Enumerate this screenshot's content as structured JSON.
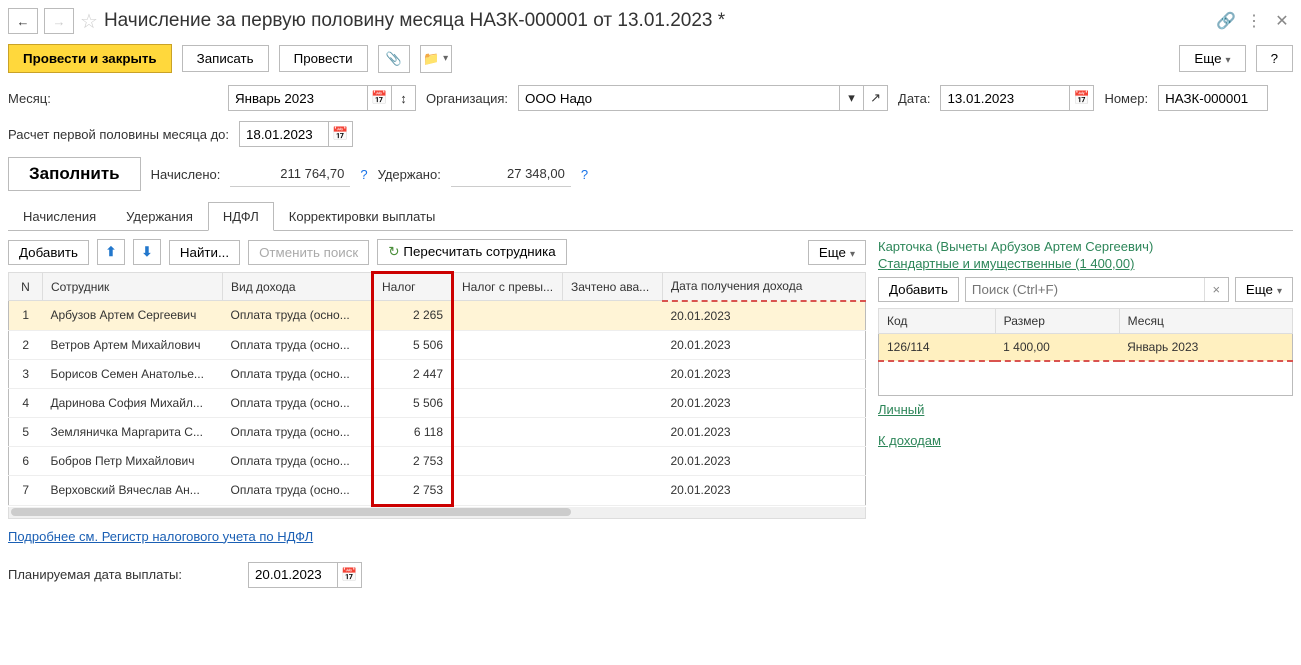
{
  "header": {
    "title": "Начисление за первую половину месяца НАЗК-000001 от 13.01.2023 *"
  },
  "toolbar": {
    "post_close": "Провести и закрыть",
    "save": "Записать",
    "post": "Провести",
    "more": "Еще"
  },
  "fields": {
    "month_label": "Месяц:",
    "month_value": "Январь 2023",
    "org_label": "Организация:",
    "org_value": "ООО Надо",
    "date_label": "Дата:",
    "date_value": "13.01.2023",
    "num_label": "Номер:",
    "num_value": "НАЗК-000001",
    "calc_until_label": "Расчет первой половины месяца до:",
    "calc_until_value": "18.01.2023",
    "fill": "Заполнить",
    "accrued_label": "Начислено:",
    "accrued_value": "211 764,70",
    "withheld_label": "Удержано:",
    "withheld_value": "27 348,00"
  },
  "tabs": {
    "t1": "Начисления",
    "t2": "Удержания",
    "t3": "НДФЛ",
    "t4": "Корректировки выплаты"
  },
  "subtb": {
    "add": "Добавить",
    "find": "Найти...",
    "cancel_find": "Отменить поиск",
    "recalc": "Пересчитать сотрудника",
    "more": "Еще"
  },
  "cols": {
    "n": "N",
    "emp": "Сотрудник",
    "inc": "Вид дохода",
    "tax": "Налог",
    "taxover": "Налог с превы...",
    "credited": "Зачтено ава...",
    "date": "Дата получения дохода"
  },
  "rows": [
    {
      "n": "1",
      "emp": "Арбузов Артем Сергеевич",
      "inc": "Оплата труда (осно...",
      "tax": "2 265",
      "date": "20.01.2023"
    },
    {
      "n": "2",
      "emp": "Ветров Артем Михайлович",
      "inc": "Оплата труда (осно...",
      "tax": "5 506",
      "date": "20.01.2023"
    },
    {
      "n": "3",
      "emp": "Борисов Семен Анатолье...",
      "inc": "Оплата труда (осно...",
      "tax": "2 447",
      "date": "20.01.2023"
    },
    {
      "n": "4",
      "emp": "Даринова София Михайл...",
      "inc": "Оплата труда (осно...",
      "tax": "5 506",
      "date": "20.01.2023"
    },
    {
      "n": "5",
      "emp": "Земляничка Маргарита С...",
      "inc": "Оплата труда (осно...",
      "tax": "6 118",
      "date": "20.01.2023"
    },
    {
      "n": "6",
      "emp": "Бобров Петр Михайлович",
      "inc": "Оплата труда (осно...",
      "tax": "2 753",
      "date": "20.01.2023"
    },
    {
      "n": "7",
      "emp": "Верховский Вячеслав Ан...",
      "inc": "Оплата труда (осно...",
      "tax": "2 753",
      "date": "20.01.2023"
    }
  ],
  "footer_link": "Подробнее см. Регистр налогового учета по НДФЛ",
  "planned_date_label": "Планируемая дата выплаты:",
  "planned_date_value": "20.01.2023",
  "right": {
    "card_title": "Карточка (Вычеты Арбузов Артем Сергеевич)",
    "std_link": "Стандартные и имущественные (1 400,00)",
    "add": "Добавить",
    "search_ph": "Поиск (Ctrl+F)",
    "more": "Еще",
    "cols": {
      "code": "Код",
      "size": "Размер",
      "month": "Месяц"
    },
    "row": {
      "code": "126/114",
      "size": "1 400,00",
      "month": "Январь 2023"
    },
    "personal": "Личный",
    "to_income": "К доходам"
  }
}
